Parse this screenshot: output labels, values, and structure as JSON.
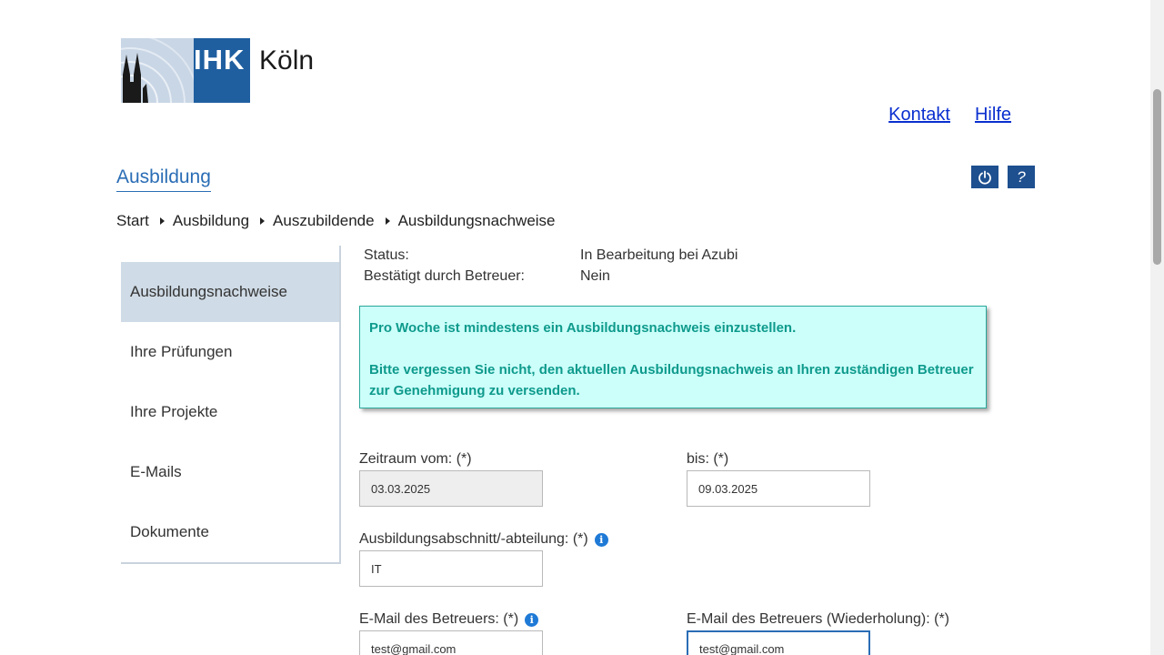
{
  "header": {
    "logo_text": "IHK",
    "logo_city": "Köln",
    "links": {
      "contact": "Kontakt",
      "help": "Hilfe"
    },
    "section_title": "Ausbildung",
    "power_icon": "power-icon",
    "help_icon": "?"
  },
  "breadcrumb": [
    "Start",
    "Ausbildung",
    "Auszubildende",
    "Ausbildungsnachweise"
  ],
  "sidebar": {
    "items": [
      {
        "label": ""
      },
      {
        "label": "Ausbildungsnachweise",
        "active": true
      },
      {
        "label": "Ihre Prüfungen"
      },
      {
        "label": "Ihre Projekte"
      },
      {
        "label": "E-Mails"
      },
      {
        "label": "Dokumente"
      }
    ]
  },
  "status": {
    "status_label": "Status:",
    "status_value": "In Bearbeitung bei Azubi",
    "confirmed_label": "Bestätigt durch Betreuer:",
    "confirmed_value": "Nein"
  },
  "notice": {
    "line1": "Pro Woche ist mindestens ein Ausbildungsnachweis einzustellen.",
    "line2": "Bitte vergessen Sie nicht, den aktuellen Ausbildungsnachweis an Ihren zuständigen Betreuer zur Genehmigung zu versenden."
  },
  "form": {
    "from_label": "Zeitraum vom: (*)",
    "from_value": "03.03.2025",
    "to_label": "bis: (*)",
    "to_value": "09.03.2025",
    "section_label": "Ausbildungsabschnitt/-abteilung: (*)",
    "section_value": "IT",
    "email_label": "E-Mail des Betreuers: (*)",
    "email_value": "test@gmail.com",
    "email_repeat_label": "E-Mail des Betreuers (Wiederholung): (*)",
    "email_repeat_value": "test@gmail.com"
  },
  "colors": {
    "brand_blue": "#1f5fa0",
    "notice_bg": "#ccfffa",
    "notice_text": "#0e9a8c",
    "sidebar_active": "#cfdbe6"
  }
}
